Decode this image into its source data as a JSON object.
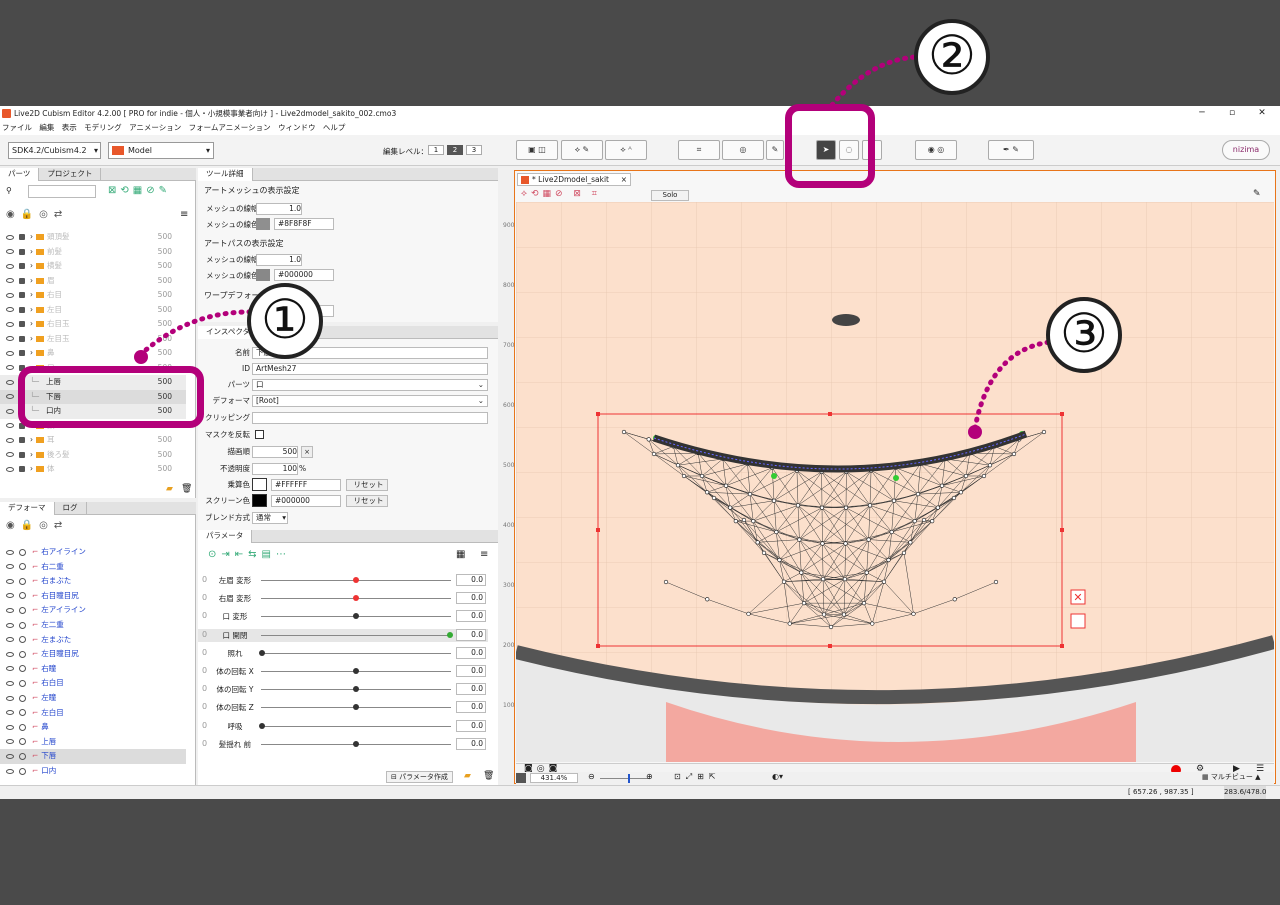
{
  "window": {
    "title": "Live2D Cubism Editor 4.2.00   [ PRO for indie - 個人・小規模事業者向け ] - Live2dmodel_sakito_002.cmo3",
    "controls": [
      "─",
      "▫",
      "✕"
    ]
  },
  "menu": [
    "ファイル",
    "編集",
    "表示",
    "モデリング",
    "アニメーション",
    "フォームアニメーション",
    "ウィンドウ",
    "ヘルプ"
  ],
  "toolbar": {
    "sdk_select": "SDK4.2/Cubism4.2",
    "mode_select": "Model",
    "edit_level_label": "編集レベル：",
    "edit_levels": [
      "1",
      "2",
      "3"
    ],
    "nizima_label": "nizima"
  },
  "parts_panel": {
    "tabs": [
      "パーツ",
      "プロジェクト"
    ],
    "rows": [
      {
        "label": "頭頂髪",
        "value": "500"
      },
      {
        "label": "前髪",
        "value": "500"
      },
      {
        "label": "横髪",
        "value": "500"
      },
      {
        "label": "眉",
        "value": "500"
      },
      {
        "label": "右目",
        "value": "500"
      },
      {
        "label": "左目",
        "value": "500"
      },
      {
        "label": "右目玉",
        "value": "500"
      },
      {
        "label": "左目玉",
        "value": "500"
      },
      {
        "label": "鼻",
        "value": "500"
      },
      {
        "label": "口",
        "value": "500"
      },
      {
        "label": "上唇",
        "value": "500"
      },
      {
        "label": "下唇",
        "value": "500"
      },
      {
        "label": "口内",
        "value": "500"
      },
      {
        "label": "顔",
        "value": "500"
      },
      {
        "label": "耳",
        "value": "500"
      },
      {
        "label": "後ろ髪",
        "value": "500"
      },
      {
        "label": "体",
        "value": "500"
      }
    ]
  },
  "deformer_panel": {
    "tabs": [
      "デフォーマ",
      "ログ"
    ],
    "rows": [
      "右アイライン",
      "右二重",
      "右まぶた",
      "右目瞳目尻",
      "左アイライン",
      "左二重",
      "左まぶた",
      "左目瞳目尻",
      "右瞳",
      "右白目",
      "左瞳",
      "左白目",
      "鼻",
      "上唇",
      "下唇",
      "口内"
    ]
  },
  "tool_detail": {
    "tab": "ツール詳細",
    "section1": "アートメッシュの表示設定",
    "mesh_width_label": "メッシュの線幅",
    "mesh_width_value": "1.0",
    "mesh_color_label": "メッシュの線色",
    "mesh_color_value": "#8F8F8F",
    "section2": "アートパスの表示設定",
    "path_width_label": "メッシュの線幅",
    "path_width_value": "1.0",
    "path_color_label": "メッシュの線色",
    "path_color_value": "#000000",
    "section3": "ワープデフォーマ"
  },
  "inspector": {
    "tab": "インスペクタ",
    "name_label": "名前",
    "name_value": "下唇",
    "id_label": "ID",
    "id_value": "ArtMesh27",
    "part_label": "パーツ",
    "part_value": "口",
    "deformer_label": "デフォーマ",
    "deformer_value": "[Root]",
    "clipping_label": "クリッピング",
    "invert_mask_label": "マスクを反転",
    "draw_order_label": "描画順",
    "draw_order_value": "500",
    "opacity_label": "不透明度",
    "opacity_value": "100",
    "multiply_label": "乗算色",
    "multiply_value": "#FFFFFF",
    "screen_label": "スクリーン色",
    "screen_value": "#000000",
    "reset_label": "リセット",
    "blend_label": "ブレンド方式",
    "blend_value": "通常"
  },
  "params": {
    "tab": "パラメータ",
    "create_label": "パラメータ作成",
    "rows": [
      {
        "label": "左眉 変形",
        "value": "0.0"
      },
      {
        "label": "右眉 変形",
        "value": "0.0"
      },
      {
        "label": "口 変形",
        "value": "0.0"
      },
      {
        "label": "口 開閉",
        "value": "0.0"
      },
      {
        "label": "照れ",
        "value": "0.0"
      },
      {
        "label": "体の回転 X",
        "value": "0.0"
      },
      {
        "label": "体の回転 Y",
        "value": "0.0"
      },
      {
        "label": "体の回転 Z",
        "value": "0.0"
      },
      {
        "label": "呼吸",
        "value": "0.0"
      },
      {
        "label": "髪揺れ 前",
        "value": "0.0"
      }
    ]
  },
  "viewport": {
    "tab_title": "* Live2Dmodel_sakit",
    "solo_label": "Solo",
    "zoom": "431.4%",
    "ruler": [
      "900",
      "800",
      "700",
      "600",
      "500",
      "400",
      "300",
      "200",
      "100"
    ],
    "multi_view_label": "マルチビュー",
    "coords": "[  657.26 ,   987.35 ]",
    "coords2": "283.6/478.0"
  },
  "annotations": [
    "①",
    "②",
    "③"
  ],
  "colors": {
    "accent": "#b3007a",
    "canvas": "#fce0cc"
  }
}
